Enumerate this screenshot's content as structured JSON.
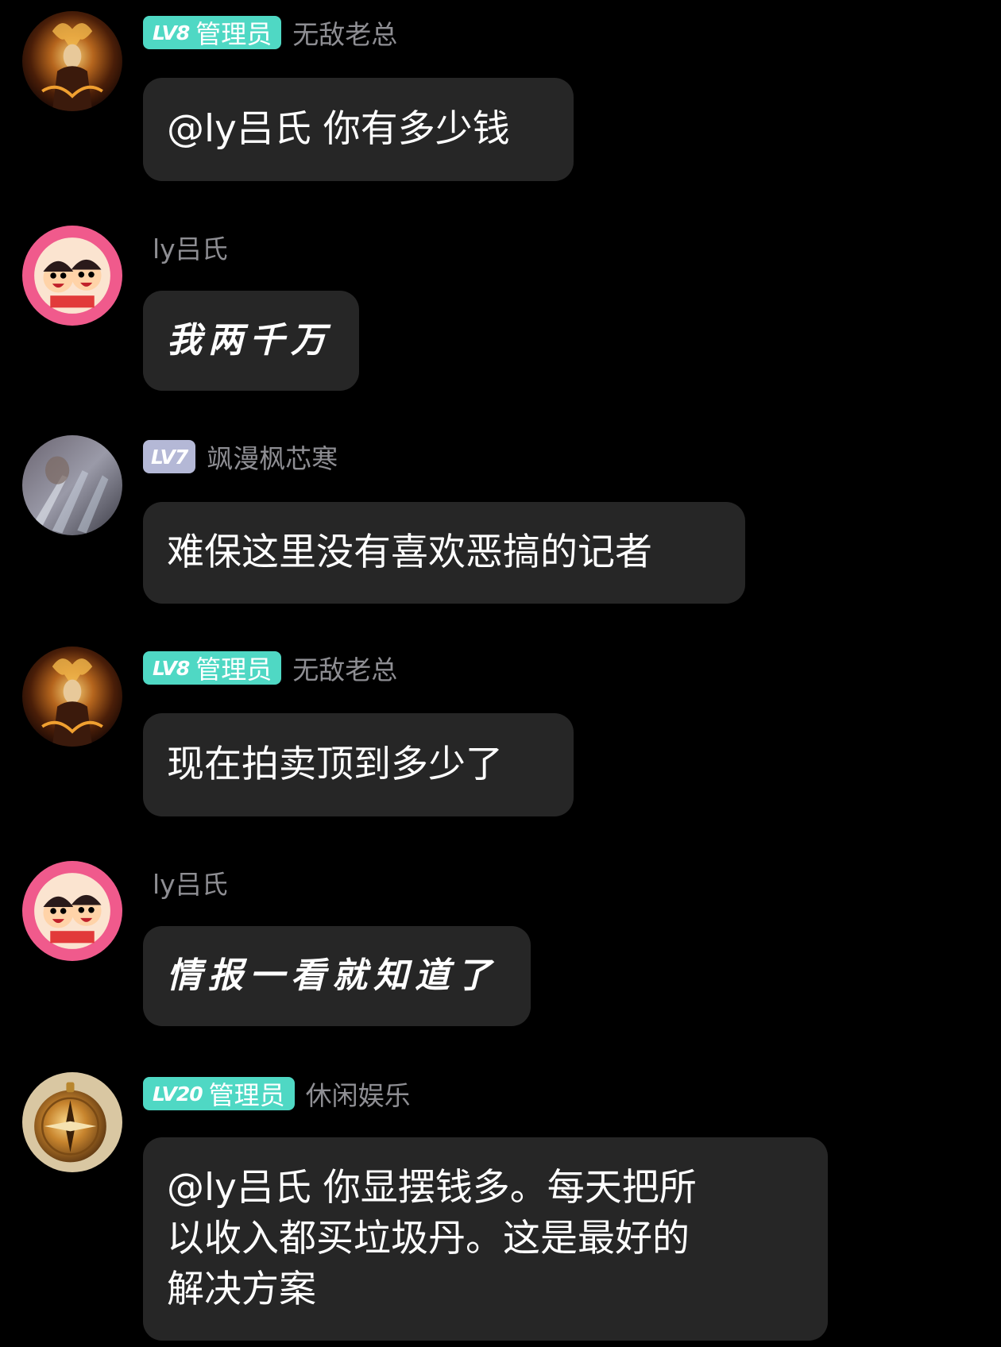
{
  "colors": {
    "background": "#000000",
    "bubble": "#262626",
    "username": "#8e8e93",
    "admin_badge": "#4fd8c4",
    "level_badge_plain": "#b4b8d6"
  },
  "messages": [
    {
      "avatar_icon": "demon-warrior-avatar",
      "badge": {
        "level": "LV8",
        "role": "管理员"
      },
      "username": "无敌老总",
      "text": "@ly吕氏 你有多少钱"
    },
    {
      "avatar_icon": "cartoon-kids-avatar",
      "badge": null,
      "username": "ly吕氏",
      "text": "我两千万"
    },
    {
      "avatar_icon": "blurry-photo-avatar",
      "badge": {
        "level": "LV7",
        "role": ""
      },
      "username": "飒漫枫芯寒",
      "text": "难保这里没有喜欢恶搞的记者"
    },
    {
      "avatar_icon": "demon-warrior-avatar",
      "badge": {
        "level": "LV8",
        "role": "管理员"
      },
      "username": "无敌老总",
      "text": "现在拍卖顶到多少了"
    },
    {
      "avatar_icon": "cartoon-kids-avatar",
      "badge": null,
      "username": "ly吕氏",
      "text": "情报一看就知道了"
    },
    {
      "avatar_icon": "compass-avatar",
      "badge": {
        "level": "LV20",
        "role": "管理员"
      },
      "username": "休闲娱乐",
      "text": "@ly吕氏 你显摆钱多。每天把所\n以收入都买垃圾丹。这是最好的\n解决方案"
    }
  ]
}
